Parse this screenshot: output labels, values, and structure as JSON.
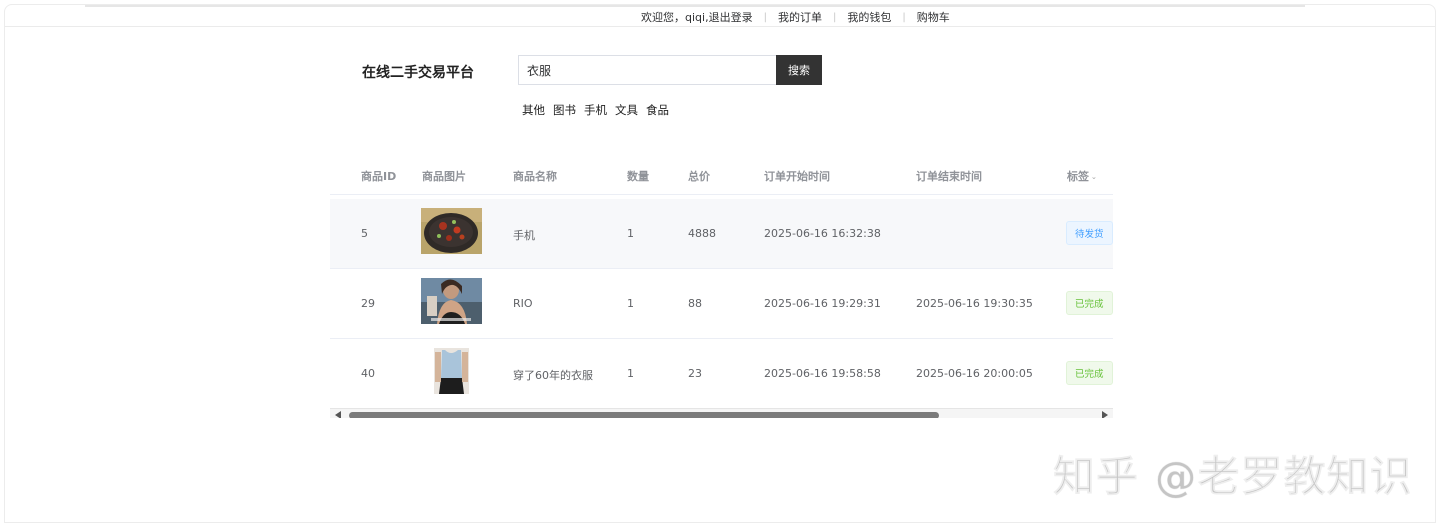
{
  "topnav": {
    "welcome": "欢迎您，qiqi,",
    "logout": "退出登录",
    "orders": "我的订单",
    "wallet": "我的钱包",
    "cart": "购物车"
  },
  "header": {
    "title": "在线二手交易平台",
    "search_value": "衣服",
    "search_button": "搜索",
    "categories": [
      "其他",
      "图书",
      "手机",
      "文具",
      "食品"
    ]
  },
  "table": {
    "columns": [
      "商品ID",
      "商品图片",
      "商品名称",
      "数量",
      "总价",
      "订单开始时间",
      "订单结束时间",
      "标签"
    ],
    "rows": [
      {
        "id": "5",
        "image": "food-photo",
        "name": "手机",
        "qty": "1",
        "total": "4888",
        "start": "2025-06-16 16:32:38",
        "end": "",
        "tag": "待发货"
      },
      {
        "id": "29",
        "image": "person-photo",
        "name": "RIO",
        "qty": "1",
        "total": "88",
        "start": "2025-06-16 19:29:31",
        "end": "2025-06-16 19:30:35",
        "tag": "已完成"
      },
      {
        "id": "40",
        "image": "tank-top-photo",
        "name": "穿了60年的衣服",
        "qty": "1",
        "total": "23",
        "start": "2025-06-16 19:58:58",
        "end": "2025-06-16 20:00:05",
        "tag": "已完成"
      }
    ]
  },
  "colors": {
    "search_button_bg": "#333333",
    "tag_pending": "#409eff",
    "tag_done": "#67c23a",
    "stripe": "#f7f8fa"
  },
  "watermark": "知乎 @老罗教知识"
}
